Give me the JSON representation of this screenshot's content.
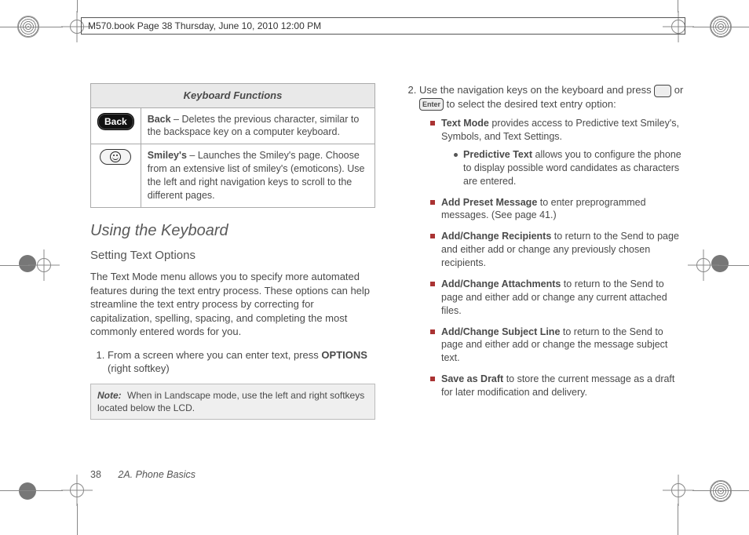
{
  "header": "M570.book  Page 38  Thursday, June 10, 2010  12:00 PM",
  "table": {
    "title": "Keyboard Functions",
    "rows": [
      {
        "label": "Back",
        "iconLabel": "Back",
        "desc": " – Deletes the previous character, similar to the backspace key on a computer keyboard."
      },
      {
        "label": "Smiley's",
        "desc": " – Launches the Smiley's page. Choose from an extensive list of smiley's (emoticons). Use the left and right navigation keys to scroll to the different pages."
      }
    ]
  },
  "section": "Using the Keyboard",
  "subsection": "Setting Text Options",
  "intro": "The Text Mode menu allows you to specify more automated features during the text entry process. These options can help streamline the text entry process by correcting for capitalization, spelling, spacing, and completing the most commonly entered words for you.",
  "step1_a": "From a screen where you can enter text, press ",
  "step1_key": "OPTIONS",
  "step1_b": " (right softkey)",
  "note_label": "Note:",
  "note_text": "When in Landscape mode, use the left and right softkeys located below the LCD.",
  "step2_a": "Use the navigation keys on the keyboard and press ",
  "step2_or": " or ",
  "step2_enter": "Enter",
  "step2_b": " to select the desired text entry option:",
  "opts": [
    {
      "term": "Text Mode",
      "rest": " provides access to Predictive text Smiley's, Symbols, and Text Settings.",
      "sub": {
        "term": "Predictive Text",
        "rest": " allows you to configure the phone to display possible word candidates as characters are entered."
      }
    },
    {
      "term": "Add Preset Message",
      "rest": " to enter preprogrammed messages. (See page 41.)"
    },
    {
      "term": "Add/Change Recipients",
      "rest": " to return to the Send to page and either add or change any previously chosen recipients."
    },
    {
      "term": "Add/Change Attachments",
      "rest": " to return to the Send to page and either add or change any current attached files."
    },
    {
      "term": "Add/Change Subject Line",
      "rest": " to return to the Send to page and either add or change the message subject text."
    },
    {
      "term": "Save as Draft",
      "rest": " to store the current message as a draft for later modification and delivery."
    }
  ],
  "footer": {
    "page": "38",
    "section": "2A. Phone Basics"
  }
}
